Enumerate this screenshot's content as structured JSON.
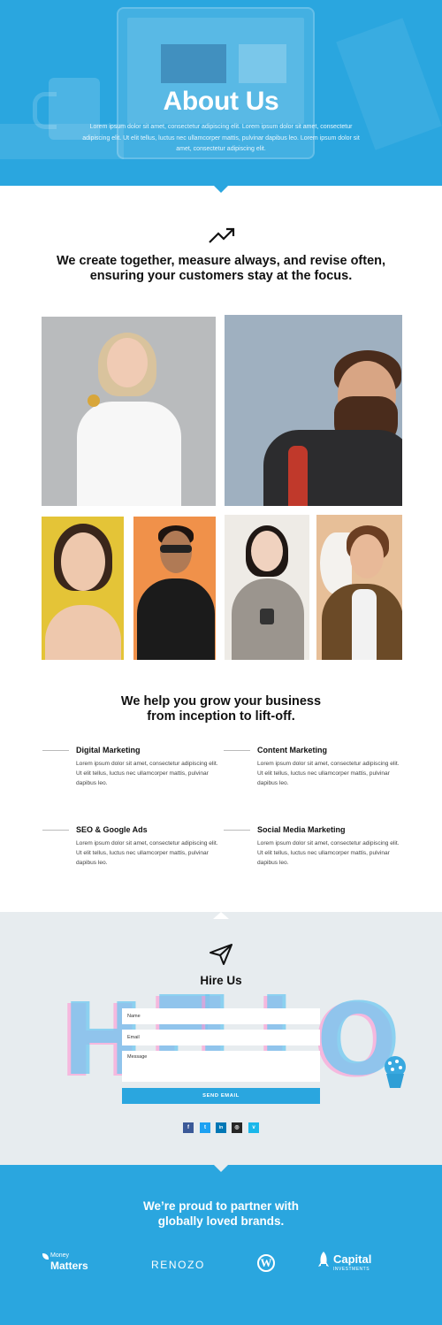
{
  "hero": {
    "title": "About Us",
    "text": "Lorem ipsum dolor sit amet, consectetur adipiscing elit. Lorem ipsum dolor sit amet, consectetur adipiscing elit. Ut elit tellus, luctus nec ullamcorper mattis, pulvinar dapibus leo. Lorem ipsum dolor sit amet, consectetur adipiscing elit."
  },
  "mission": {
    "icon": "trend-up-icon",
    "line1": "We create together, measure always, and revise often,",
    "line2": "ensuring your customers stay at the focus."
  },
  "help": {
    "line1": "We help you grow your business",
    "line2": "from inception to lift-off."
  },
  "services": [
    {
      "title": "Digital Marketing",
      "text": "Lorem ipsum dolor sit amet, consectetur adipiscing elit. Ut elit tellus, luctus nec ullamcorper mattis, pulvinar dapibus leo."
    },
    {
      "title": "Content Marketing",
      "text": "Lorem ipsum dolor sit amet, consectetur adipiscing elit. Ut elit tellus, luctus nec ullamcorper mattis, pulvinar dapibus leo."
    },
    {
      "title": "SEO & Google Ads",
      "text": "Lorem ipsum dolor sit amet, consectetur adipiscing elit. Ut elit tellus, luctus nec ullamcorper mattis, pulvinar dapibus leo."
    },
    {
      "title": "Social Media Marketing",
      "text": "Lorem ipsum dolor sit amet, consectetur adipiscing elit. Ut elit tellus, luctus nec ullamcorper mattis, pulvinar dapibus leo."
    }
  ],
  "hire": {
    "icon": "paper-plane-icon",
    "title": "Hire Us",
    "backdrop_letters": [
      "H",
      "E",
      "L",
      "L",
      "O"
    ],
    "name_placeholder": "Name",
    "email_placeholder": "Email",
    "message_placeholder": "Message",
    "submit_label": "SEND EMAIL",
    "social": [
      {
        "icon": "facebook-icon",
        "glyph": "f",
        "color": "#3b5998"
      },
      {
        "icon": "twitter-icon",
        "glyph": "t",
        "color": "#1da1f2"
      },
      {
        "icon": "linkedin-icon",
        "glyph": "in",
        "color": "#0077b5"
      },
      {
        "icon": "instagram-icon",
        "glyph": "◎",
        "color": "#262626"
      },
      {
        "icon": "vimeo-icon",
        "glyph": "v",
        "color": "#1ab7ea"
      }
    ]
  },
  "partners": {
    "line1": "We’re proud to partner with",
    "line2": "globally loved brands.",
    "brands": {
      "money_small": "Money",
      "money_big": "Matters",
      "renozo": "RENOZO",
      "wordpress_glyph": "W",
      "capital": "Capital",
      "capital_sub": "INVESTMENTS"
    }
  },
  "colors": {
    "accent": "#2aa6df",
    "hire_bg": "#e7ecef"
  }
}
